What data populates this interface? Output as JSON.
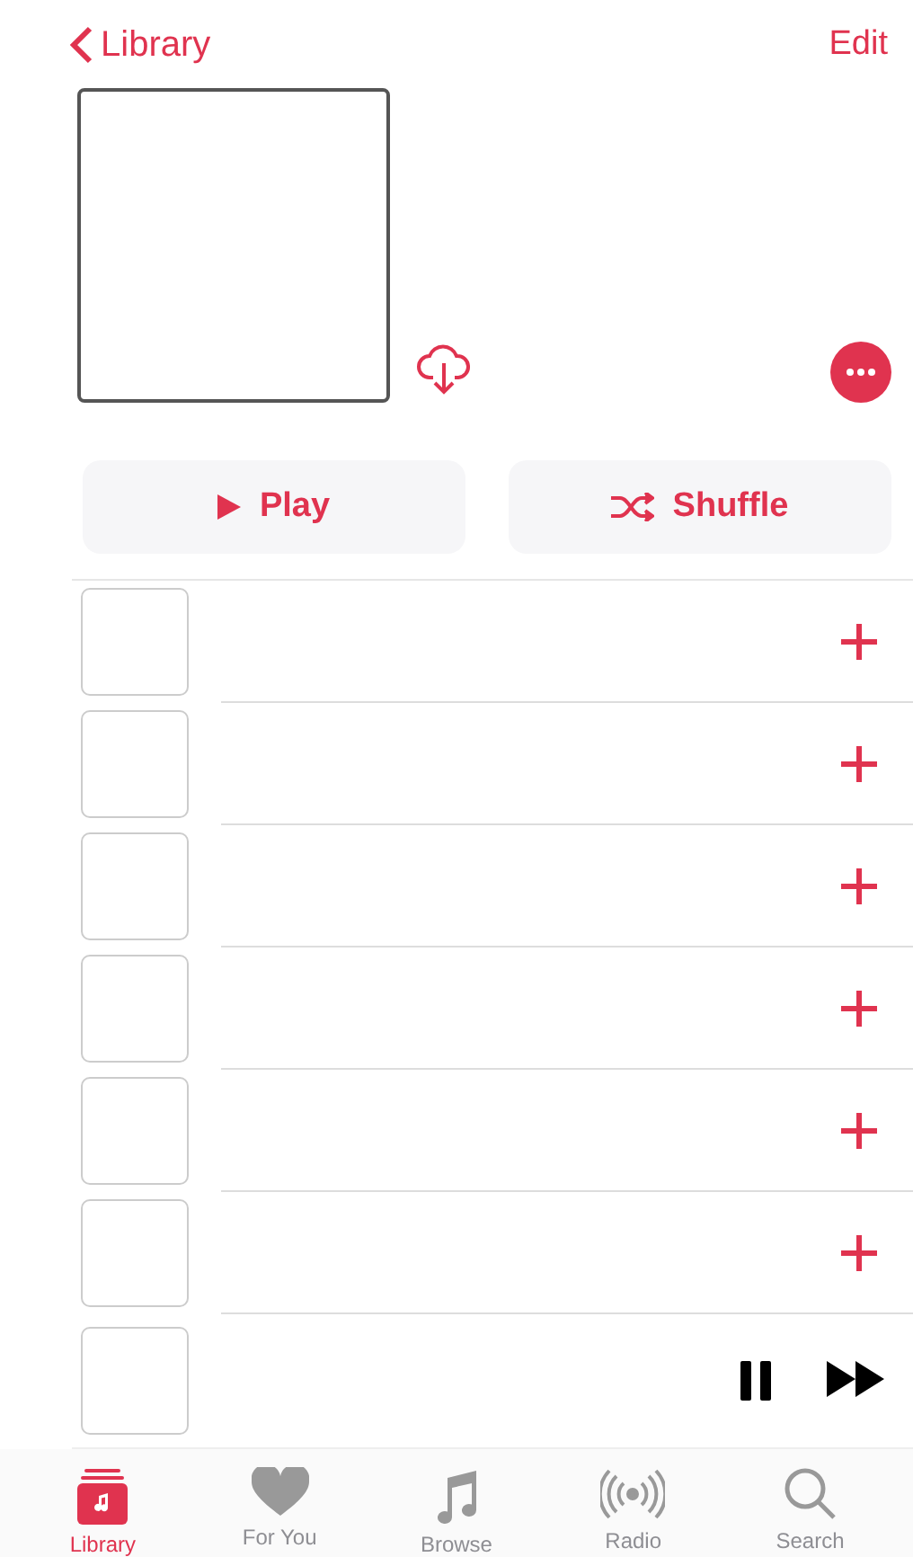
{
  "nav": {
    "back_label": "Library",
    "action": "Edit"
  },
  "actions": [
    {
      "kind": "play",
      "label": "Play"
    },
    {
      "kind": "shuffle",
      "label": "Shuffle"
    }
  ],
  "tracks": [
    {
      "kind": "song"
    },
    {
      "kind": "song"
    },
    {
      "kind": "song"
    },
    {
      "kind": "song"
    },
    {
      "kind": "song"
    },
    {
      "kind": "song"
    }
  ],
  "mini_player": {
    "playing": true
  },
  "tabs": [
    {
      "kind": "library",
      "label": "Library",
      "selected": true
    },
    {
      "kind": "foryou",
      "label": "For You",
      "selected": false
    },
    {
      "kind": "browse",
      "label": "Browse",
      "selected": false
    },
    {
      "kind": "radio",
      "label": "Radio",
      "selected": false
    },
    {
      "kind": "search",
      "label": "Search",
      "selected": false
    }
  ]
}
